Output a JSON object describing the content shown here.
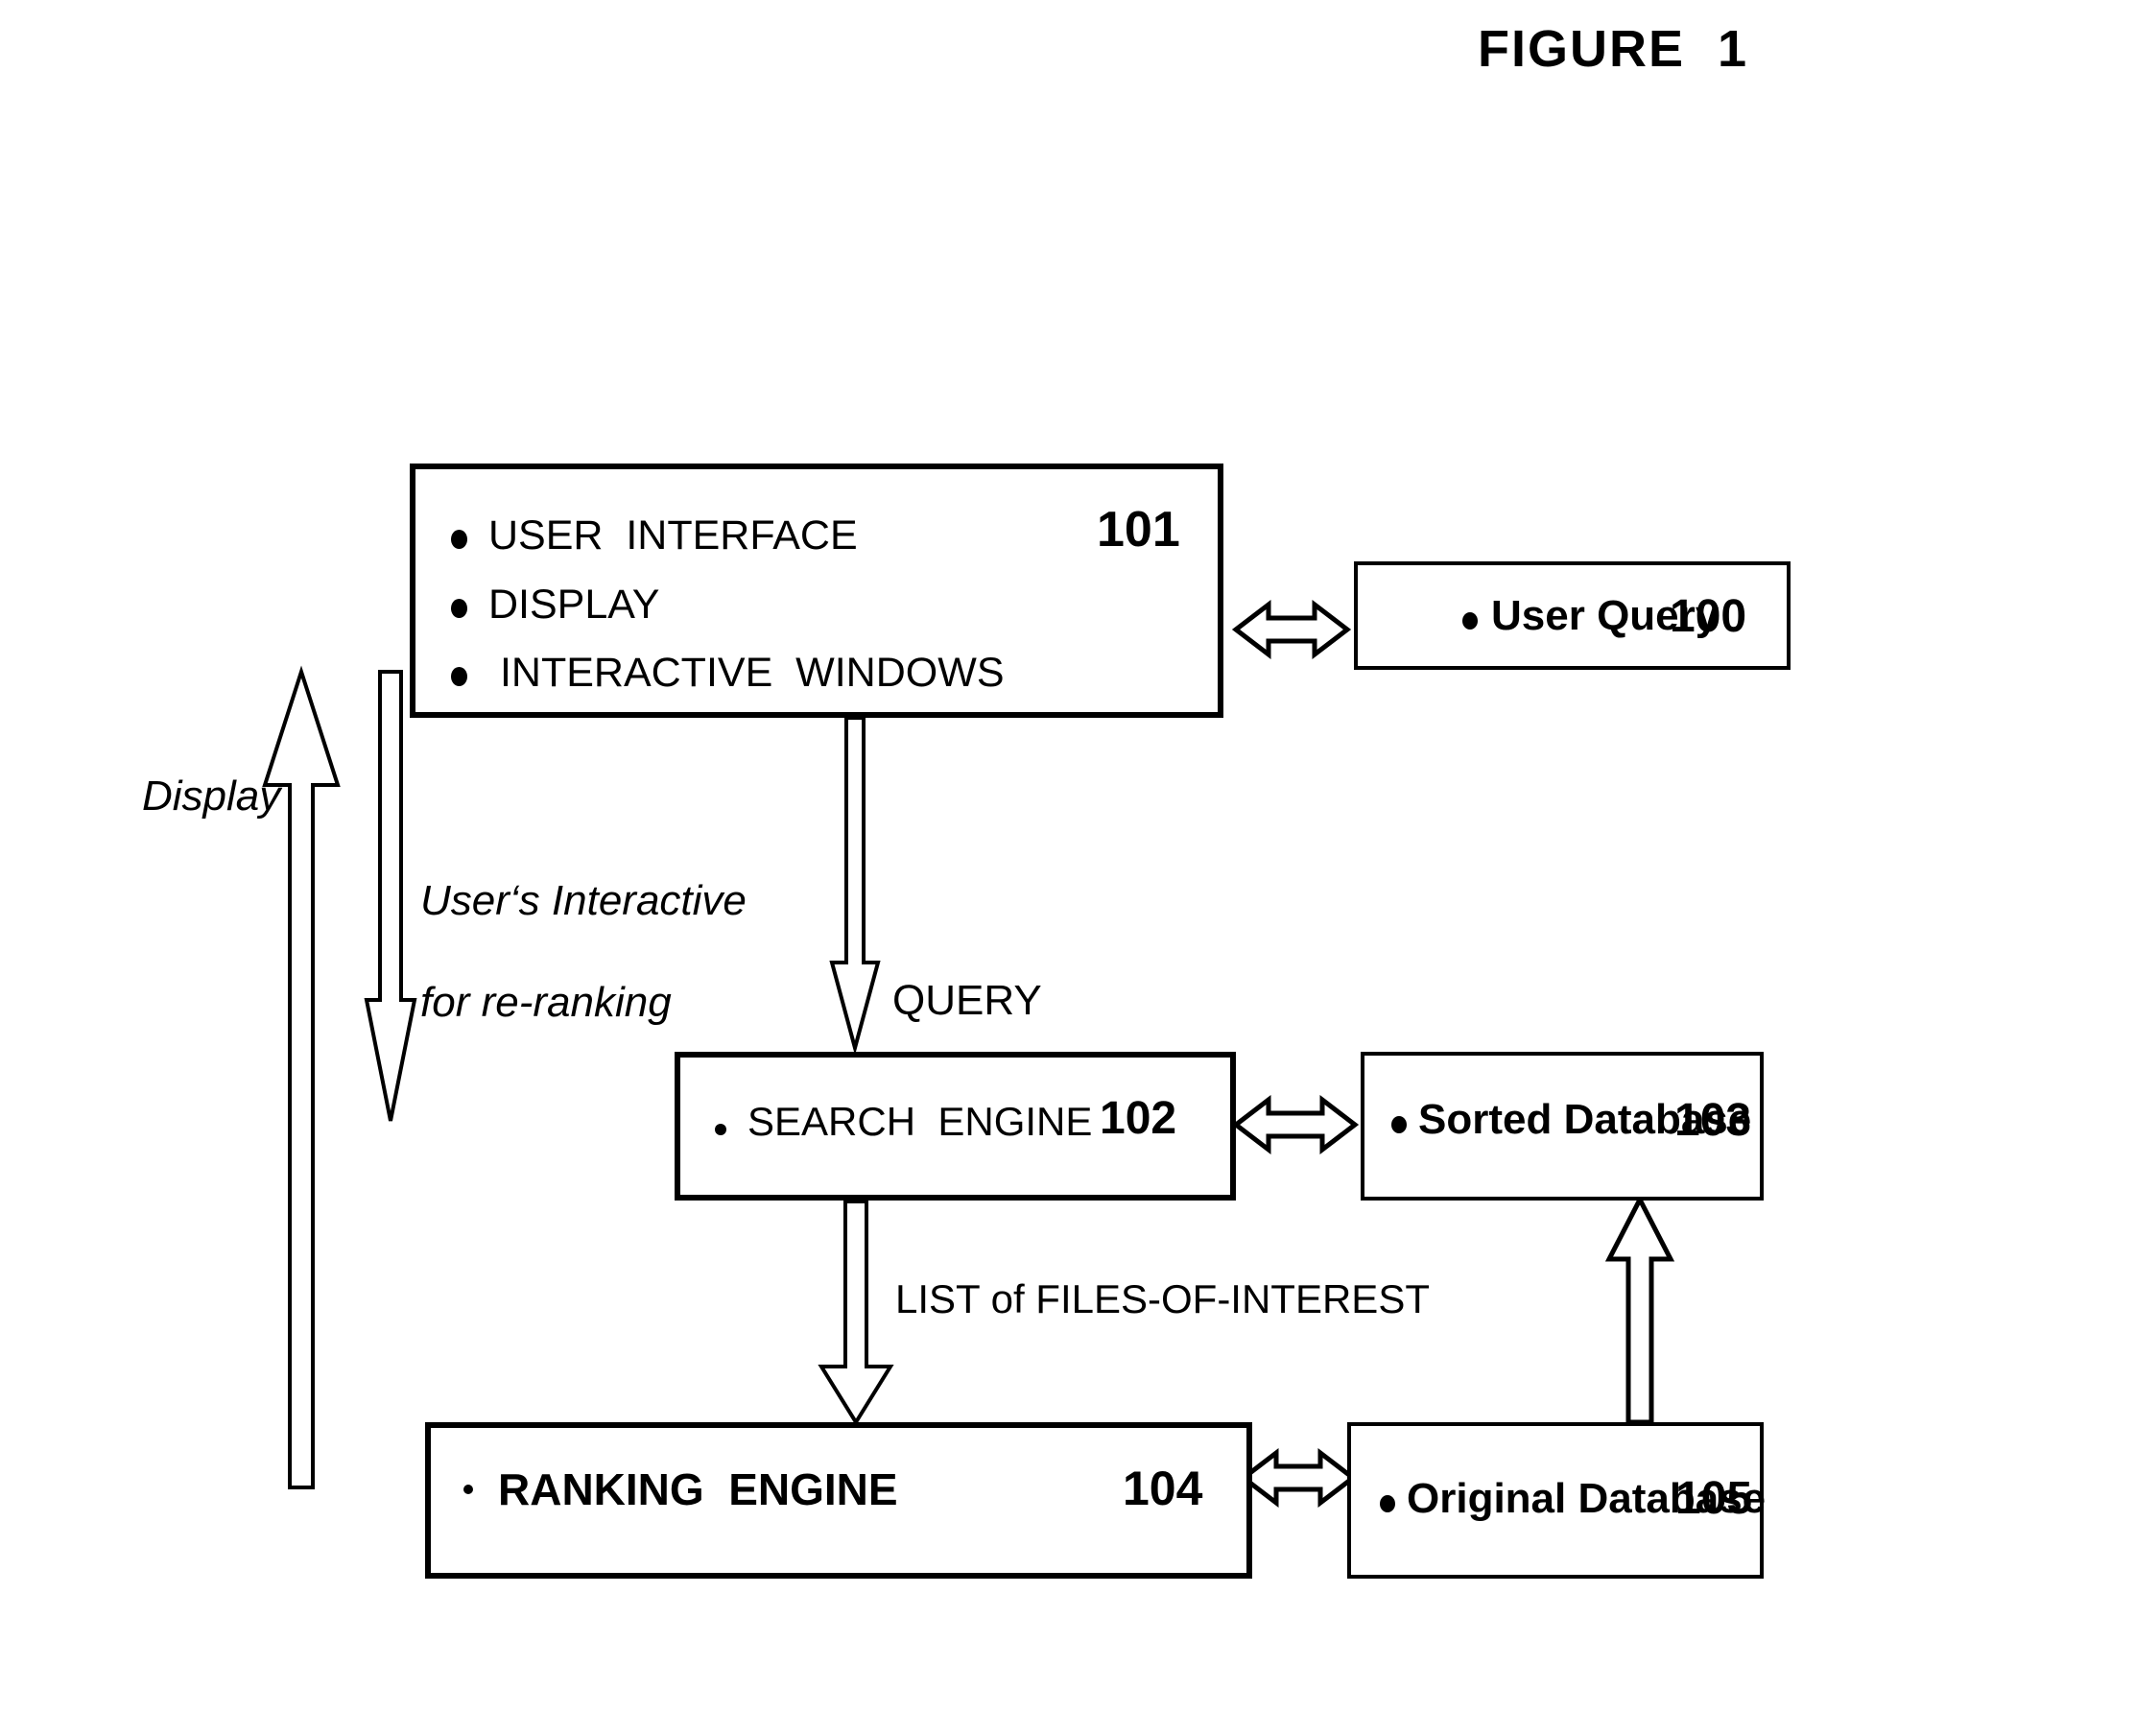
{
  "figure": {
    "title": "FIGURE  1"
  },
  "boxes": {
    "ui": {
      "id": "101",
      "items": [
        "USER  INTERFACE",
        "DISPLAY",
        " INTERACTIVE  WINDOWS"
      ]
    },
    "user_query": {
      "id": "100",
      "label": "User Query"
    },
    "search_engine": {
      "id": "102",
      "label": "SEARCH  ENGINE"
    },
    "sorted_database": {
      "id": "103",
      "label": "Sorted Database"
    },
    "ranking_engine": {
      "id": "104",
      "label": "RANKING  ENGINE"
    },
    "original_database": {
      "id": "105",
      "label": "Original Database"
    }
  },
  "annotations": {
    "display": "Display",
    "interactive_line1": "User‘s Interactive",
    "interactive_line2": "for re-ranking",
    "query": "QUERY",
    "list_of_files": "LIST of FILES-OF-INTEREST"
  },
  "colors": {
    "ink": "#000000",
    "paper": "#ffffff"
  }
}
